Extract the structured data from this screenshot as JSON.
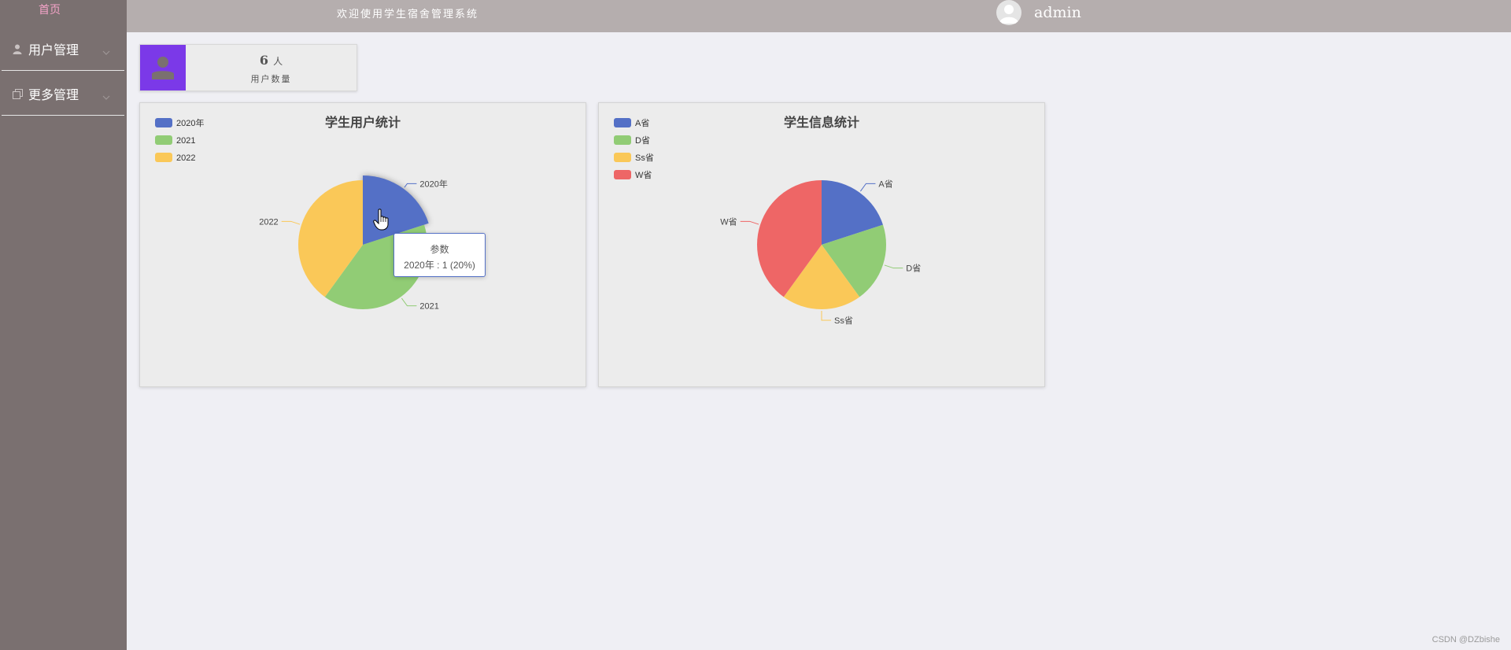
{
  "sidebar": {
    "home_label": "首页",
    "menus": [
      {
        "label": "用户管理",
        "icon": "user-icon"
      },
      {
        "label": "更多管理",
        "icon": "copy-icon"
      }
    ]
  },
  "header": {
    "welcome": "欢迎使用学生宿舍管理系统",
    "username": "admin"
  },
  "stats": {
    "count": "6",
    "unit": "人",
    "label": "用户数量"
  },
  "chart_data": [
    {
      "type": "pie",
      "title": "学生用户统计",
      "categories": [
        "2020年",
        "2021",
        "2022"
      ],
      "values": [
        1,
        2,
        2
      ],
      "colors": [
        "#5470c6",
        "#91cc75",
        "#fac858"
      ],
      "highlighted": "2020年",
      "tooltip": {
        "title": "参数",
        "text": "2020年 : 1 (20%)"
      }
    },
    {
      "type": "pie",
      "title": "学生信息统计",
      "categories": [
        "A省",
        "D省",
        "Ss省",
        "W省"
      ],
      "values": [
        1,
        1,
        1,
        2
      ],
      "colors": [
        "#5470c6",
        "#91cc75",
        "#fac858",
        "#ee6666"
      ]
    }
  ],
  "watermark": "CSDN @DZbishe"
}
